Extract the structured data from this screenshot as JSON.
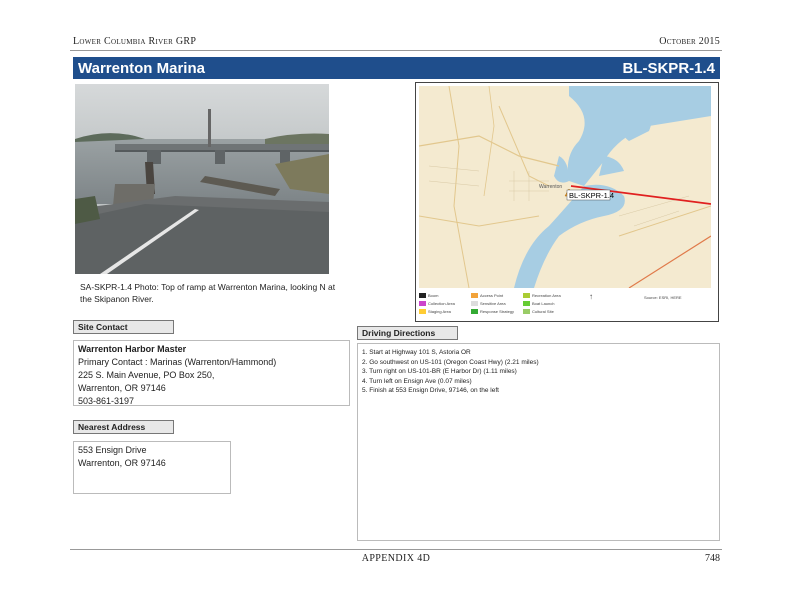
{
  "header": {
    "left": "Lower Columbia River GRP",
    "right": "October 2015"
  },
  "title_bar": {
    "name": "Warrenton Marina",
    "code": "BL-SKPR-1.4"
  },
  "photo": {
    "caption": "SA-SKPR-1.4 Photo: Top of ramp at Warrenton Marina, looking N at the Skipanon River."
  },
  "map": {
    "site_label": "BL-SKPR-1.4",
    "legend": [
      {
        "label": "Boom",
        "color": "#222222"
      },
      {
        "label": "Collection Area",
        "color": "#cc44cc"
      },
      {
        "label": "Staging Area",
        "color": "#ffcc33"
      },
      {
        "label": "Access Point",
        "color": "#f2a33a"
      },
      {
        "label": "Sensitive Area",
        "color": "#dddddd"
      },
      {
        "label": "Response Strategy",
        "color": "#33aa33"
      },
      {
        "label": "Recreation Area",
        "color": "#aacc33"
      },
      {
        "label": "Boat Launch",
        "color": "#66cc33"
      },
      {
        "label": "Cultural Site",
        "color": "#99cc66"
      }
    ],
    "scale_note": "Source: ESRI, HERE"
  },
  "site_contact": {
    "label": "Site Contact",
    "name": "Warrenton Harbor Master",
    "lines": [
      "Primary Contact : Marinas (Warrenton/Hammond)",
      "225 S. Main Avenue, PO Box 250,",
      "Warrenton, OR 97146",
      "503-861-3197"
    ]
  },
  "nearest_address": {
    "label": "Nearest Address",
    "lines": [
      "553 Ensign Drive",
      "Warrenton, OR 97146"
    ]
  },
  "driving_directions": {
    "label": "Driving Directions",
    "steps": [
      "1. Start at Highway 101 S, Astoria OR",
      "2. Go southwest on US-101 (Oregon Coast Hwy) (2.21 miles)",
      "3. Turn right on US-101-BR (E Harbor Dr) (1.11 miles)",
      "4. Turn left on Ensign Ave (0.07 miles)",
      "5. Finish at 553 Ensign Drive, 97146, on the left"
    ]
  },
  "footer": {
    "center": "APPENDIX 4D",
    "page": "748"
  }
}
